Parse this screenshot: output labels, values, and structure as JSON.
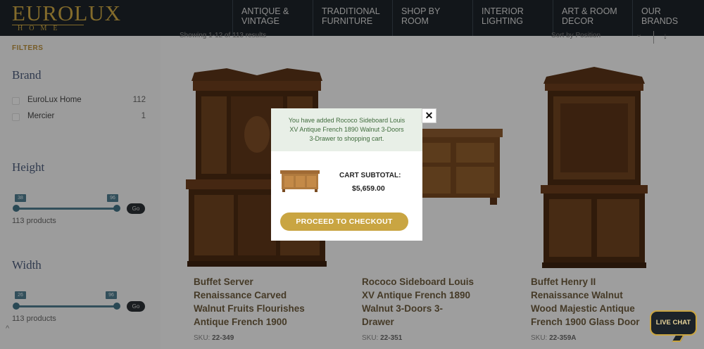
{
  "header": {
    "logo_main": "EUROLUX",
    "logo_sub": "HOME",
    "nav": [
      {
        "line1": "ANTIQUE &",
        "line2": "VINTAGE"
      },
      {
        "line1": "TRADITIONAL",
        "line2": "FURNITURE"
      },
      {
        "line1": "SHOP BY",
        "line2": "ROOM"
      },
      {
        "line1": "INTERIOR",
        "line2": "LIGHTING"
      },
      {
        "line1": "ART & ROOM",
        "line2": "DECOR"
      },
      {
        "line1": "OUR",
        "line2": "BRANDS"
      }
    ]
  },
  "sidebar": {
    "filters_label": "FILTERS",
    "brand_heading": "Brand",
    "brands": [
      {
        "name": "EuroLux Home",
        "count": "112"
      },
      {
        "name": "Mercier",
        "count": "1"
      }
    ],
    "height_heading": "Height",
    "height_min": "38",
    "height_max": "96",
    "height_products": "113 products",
    "width_heading": "Width",
    "width_min": "26",
    "width_max": "96",
    "width_products": "113 products",
    "go_label": "Go"
  },
  "main": {
    "showing": "Showing 1-12 of 113 results",
    "sort_label": "Sort by Position",
    "sort_chevron": "⌄",
    "sort_direction": "↓",
    "products": [
      {
        "title_lines": [
          "Buffet Server",
          "Renaissance Carved",
          "Walnut Fruits Flourishes",
          "Antique French 1900"
        ],
        "sku_label": "SKU:",
        "sku": "22-349"
      },
      {
        "title_lines": [
          "Rococo Sideboard Louis",
          "XV Antique French 1890",
          "Walnut 3-Doors 3-",
          "Drawer"
        ],
        "sku_label": "SKU:",
        "sku": "22-351"
      },
      {
        "title_lines": [
          "Buffet Henry II",
          "Renaissance Walnut",
          "Wood Majestic Antique",
          "French 1900 Glass Door"
        ],
        "sku_label": "SKU:",
        "sku": "22-359A"
      }
    ]
  },
  "modal": {
    "message_lines": [
      "You have added Rococo Sideboard Louis",
      "XV Antique French 1890 Walnut 3-Doors",
      "3-Drawer to shopping cart."
    ],
    "subtotal_label": "CART SUBTOTAL:",
    "subtotal_value": "$5,659.00",
    "checkout_label": "PROCEED TO CHECKOUT",
    "close_symbol": "✕"
  },
  "live_chat": {
    "label": "LIVE CHAT"
  },
  "colors": {
    "accent": "#c9a542",
    "header_bg": "#1c2329",
    "slider": "#4d7a8c"
  }
}
